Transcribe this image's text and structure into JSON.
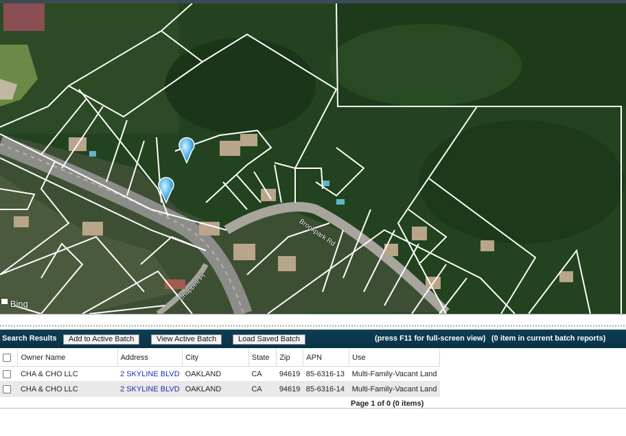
{
  "map": {
    "provider_label": "Bing",
    "road_labels": [
      "Brookpark Rd",
      "Chappell Pl"
    ]
  },
  "toolbar": {
    "title": "Search Results",
    "add_to_batch": "Add to Active Batch",
    "view_batch": "View Active Batch",
    "load_batch": "Load Saved Batch",
    "hint": "(press F11 for full-screen view)",
    "batch_count": "(0 item in current batch reports)"
  },
  "table": {
    "columns": [
      "Owner Name",
      "Address",
      "City",
      "State",
      "Zip",
      "APN",
      "Use"
    ],
    "rows": [
      {
        "owner": "CHA & CHO LLC",
        "address": "2 SKYLINE BLVD",
        "city": "OAKLAND",
        "state": "CA",
        "zip": "94619",
        "apn": "85-6316-13",
        "use": "Multi-Family-Vacant Land"
      },
      {
        "owner": "CHA & CHO LLC",
        "address": "2 SKYLINE BLVD",
        "city": "OAKLAND",
        "state": "CA",
        "zip": "94619",
        "apn": "85-6316-14",
        "use": "Multi-Family-Vacant Land"
      }
    ]
  },
  "pager": {
    "text": "Page 1 of 0 (0 items)"
  }
}
